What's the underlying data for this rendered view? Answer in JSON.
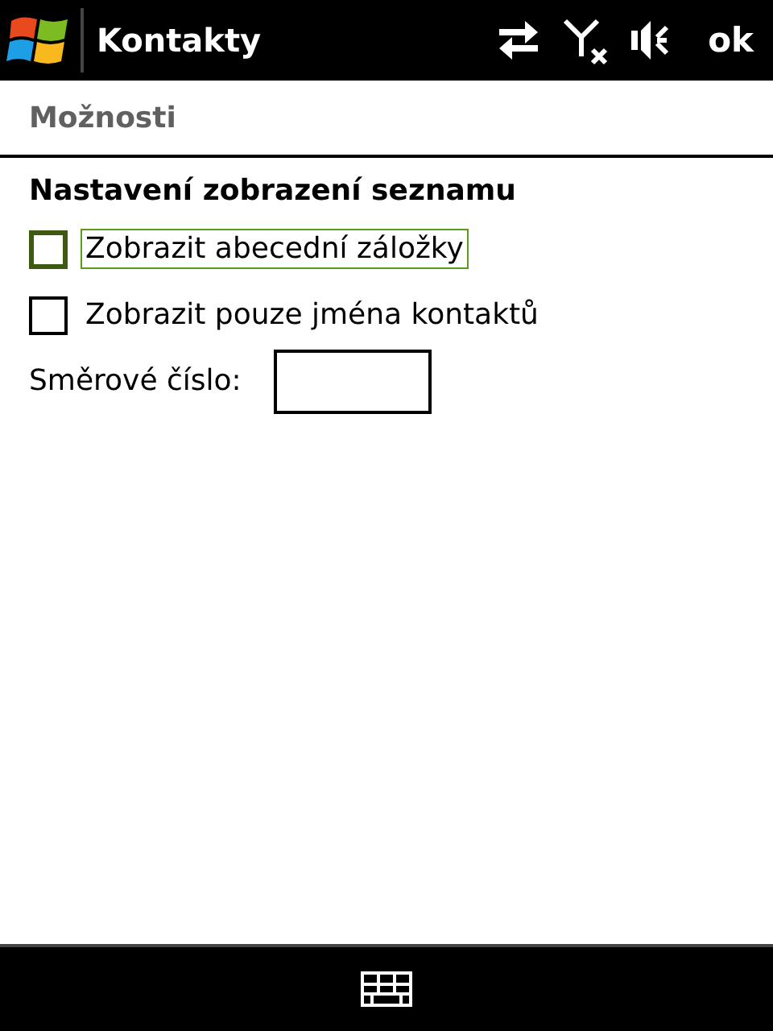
{
  "title_bar": {
    "title": "Kontakty",
    "ok": "ok"
  },
  "page_header": "Možnosti",
  "section_title": "Nastavení zobrazení seznamu",
  "options": [
    {
      "label": "Zobrazit abecední záložky",
      "checked": false,
      "focused": true
    },
    {
      "label": "Zobrazit pouze jména kontaktů",
      "checked": false,
      "focused": false
    }
  ],
  "area_code": {
    "label": "Směrové číslo:"
  }
}
